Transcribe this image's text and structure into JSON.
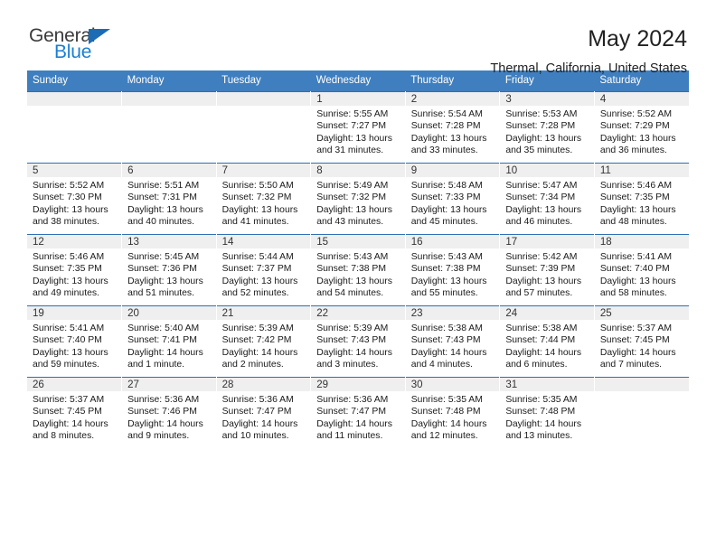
{
  "brand": {
    "name_part1": "General",
    "name_part2": "Blue",
    "triangle_color": "#1b6cb5",
    "blue_color": "#1b7fd4",
    "logo_icon": "general-blue-logo-icon"
  },
  "header": {
    "title": "May 2024",
    "subtitle": "Thermal, California, United States"
  },
  "theme": {
    "header_row_bg": "#3f7fbf",
    "day_number_bg": "#efefef",
    "cell_border": "#2f6fb2",
    "text": "#1a1a1a"
  },
  "weekday_headers": [
    "Sunday",
    "Monday",
    "Tuesday",
    "Wednesday",
    "Thursday",
    "Friday",
    "Saturday"
  ],
  "labels": {
    "sunrise": "Sunrise:",
    "sunset": "Sunset:",
    "daylight": "Daylight:"
  },
  "weeks": [
    [
      {
        "day": "",
        "blank": true,
        "sunrise": "",
        "sunset": "",
        "daylight": ""
      },
      {
        "day": "",
        "blank": true,
        "sunrise": "",
        "sunset": "",
        "daylight": ""
      },
      {
        "day": "",
        "blank": true,
        "sunrise": "",
        "sunset": "",
        "daylight": ""
      },
      {
        "day": "1",
        "sunrise": "Sunrise: 5:55 AM",
        "sunset": "Sunset: 7:27 PM",
        "daylight": "Daylight: 13 hours and 31 minutes."
      },
      {
        "day": "2",
        "sunrise": "Sunrise: 5:54 AM",
        "sunset": "Sunset: 7:28 PM",
        "daylight": "Daylight: 13 hours and 33 minutes."
      },
      {
        "day": "3",
        "sunrise": "Sunrise: 5:53 AM",
        "sunset": "Sunset: 7:28 PM",
        "daylight": "Daylight: 13 hours and 35 minutes."
      },
      {
        "day": "4",
        "sunrise": "Sunrise: 5:52 AM",
        "sunset": "Sunset: 7:29 PM",
        "daylight": "Daylight: 13 hours and 36 minutes."
      }
    ],
    [
      {
        "day": "5",
        "sunrise": "Sunrise: 5:52 AM",
        "sunset": "Sunset: 7:30 PM",
        "daylight": "Daylight: 13 hours and 38 minutes."
      },
      {
        "day": "6",
        "sunrise": "Sunrise: 5:51 AM",
        "sunset": "Sunset: 7:31 PM",
        "daylight": "Daylight: 13 hours and 40 minutes."
      },
      {
        "day": "7",
        "sunrise": "Sunrise: 5:50 AM",
        "sunset": "Sunset: 7:32 PM",
        "daylight": "Daylight: 13 hours and 41 minutes."
      },
      {
        "day": "8",
        "sunrise": "Sunrise: 5:49 AM",
        "sunset": "Sunset: 7:32 PM",
        "daylight": "Daylight: 13 hours and 43 minutes."
      },
      {
        "day": "9",
        "sunrise": "Sunrise: 5:48 AM",
        "sunset": "Sunset: 7:33 PM",
        "daylight": "Daylight: 13 hours and 45 minutes."
      },
      {
        "day": "10",
        "sunrise": "Sunrise: 5:47 AM",
        "sunset": "Sunset: 7:34 PM",
        "daylight": "Daylight: 13 hours and 46 minutes."
      },
      {
        "day": "11",
        "sunrise": "Sunrise: 5:46 AM",
        "sunset": "Sunset: 7:35 PM",
        "daylight": "Daylight: 13 hours and 48 minutes."
      }
    ],
    [
      {
        "day": "12",
        "sunrise": "Sunrise: 5:46 AM",
        "sunset": "Sunset: 7:35 PM",
        "daylight": "Daylight: 13 hours and 49 minutes."
      },
      {
        "day": "13",
        "sunrise": "Sunrise: 5:45 AM",
        "sunset": "Sunset: 7:36 PM",
        "daylight": "Daylight: 13 hours and 51 minutes."
      },
      {
        "day": "14",
        "sunrise": "Sunrise: 5:44 AM",
        "sunset": "Sunset: 7:37 PM",
        "daylight": "Daylight: 13 hours and 52 minutes."
      },
      {
        "day": "15",
        "sunrise": "Sunrise: 5:43 AM",
        "sunset": "Sunset: 7:38 PM",
        "daylight": "Daylight: 13 hours and 54 minutes."
      },
      {
        "day": "16",
        "sunrise": "Sunrise: 5:43 AM",
        "sunset": "Sunset: 7:38 PM",
        "daylight": "Daylight: 13 hours and 55 minutes."
      },
      {
        "day": "17",
        "sunrise": "Sunrise: 5:42 AM",
        "sunset": "Sunset: 7:39 PM",
        "daylight": "Daylight: 13 hours and 57 minutes."
      },
      {
        "day": "18",
        "sunrise": "Sunrise: 5:41 AM",
        "sunset": "Sunset: 7:40 PM",
        "daylight": "Daylight: 13 hours and 58 minutes."
      }
    ],
    [
      {
        "day": "19",
        "sunrise": "Sunrise: 5:41 AM",
        "sunset": "Sunset: 7:40 PM",
        "daylight": "Daylight: 13 hours and 59 minutes."
      },
      {
        "day": "20",
        "sunrise": "Sunrise: 5:40 AM",
        "sunset": "Sunset: 7:41 PM",
        "daylight": "Daylight: 14 hours and 1 minute."
      },
      {
        "day": "21",
        "sunrise": "Sunrise: 5:39 AM",
        "sunset": "Sunset: 7:42 PM",
        "daylight": "Daylight: 14 hours and 2 minutes."
      },
      {
        "day": "22",
        "sunrise": "Sunrise: 5:39 AM",
        "sunset": "Sunset: 7:43 PM",
        "daylight": "Daylight: 14 hours and 3 minutes."
      },
      {
        "day": "23",
        "sunrise": "Sunrise: 5:38 AM",
        "sunset": "Sunset: 7:43 PM",
        "daylight": "Daylight: 14 hours and 4 minutes."
      },
      {
        "day": "24",
        "sunrise": "Sunrise: 5:38 AM",
        "sunset": "Sunset: 7:44 PM",
        "daylight": "Daylight: 14 hours and 6 minutes."
      },
      {
        "day": "25",
        "sunrise": "Sunrise: 5:37 AM",
        "sunset": "Sunset: 7:45 PM",
        "daylight": "Daylight: 14 hours and 7 minutes."
      }
    ],
    [
      {
        "day": "26",
        "sunrise": "Sunrise: 5:37 AM",
        "sunset": "Sunset: 7:45 PM",
        "daylight": "Daylight: 14 hours and 8 minutes."
      },
      {
        "day": "27",
        "sunrise": "Sunrise: 5:36 AM",
        "sunset": "Sunset: 7:46 PM",
        "daylight": "Daylight: 14 hours and 9 minutes."
      },
      {
        "day": "28",
        "sunrise": "Sunrise: 5:36 AM",
        "sunset": "Sunset: 7:47 PM",
        "daylight": "Daylight: 14 hours and 10 minutes."
      },
      {
        "day": "29",
        "sunrise": "Sunrise: 5:36 AM",
        "sunset": "Sunset: 7:47 PM",
        "daylight": "Daylight: 14 hours and 11 minutes."
      },
      {
        "day": "30",
        "sunrise": "Sunrise: 5:35 AM",
        "sunset": "Sunset: 7:48 PM",
        "daylight": "Daylight: 14 hours and 12 minutes."
      },
      {
        "day": "31",
        "sunrise": "Sunrise: 5:35 AM",
        "sunset": "Sunset: 7:48 PM",
        "daylight": "Daylight: 14 hours and 13 minutes."
      },
      {
        "day": "",
        "blank": true,
        "sunrise": "",
        "sunset": "",
        "daylight": ""
      }
    ]
  ]
}
